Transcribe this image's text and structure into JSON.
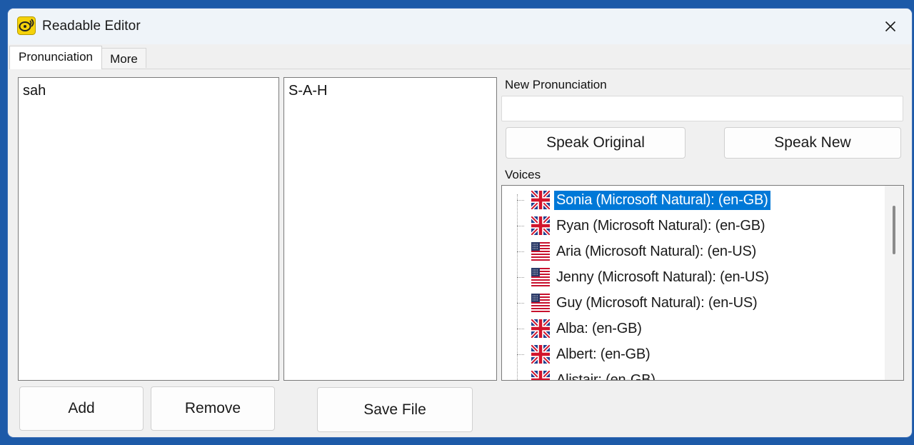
{
  "window": {
    "title": "Readable Editor"
  },
  "tabs": [
    {
      "label": "Pronunciation",
      "active": true
    },
    {
      "label": "More",
      "active": false
    }
  ],
  "words_list": {
    "items": [
      "sah"
    ]
  },
  "pronunciations_list": {
    "items": [
      "S-A-H"
    ]
  },
  "new_pronunciation": {
    "label": "New Pronunciation",
    "value": ""
  },
  "buttons": {
    "speak_original": "Speak Original",
    "speak_new": "Speak New",
    "add": "Add",
    "remove": "Remove",
    "save_file": "Save File"
  },
  "voices": {
    "label": "Voices",
    "items": [
      {
        "text": "Sonia (Microsoft Natural): (en-GB)",
        "flag": "uk-flag-icon",
        "selected": true
      },
      {
        "text": "Ryan (Microsoft Natural): (en-GB)",
        "flag": "uk-flag-icon",
        "selected": false
      },
      {
        "text": "Aria (Microsoft Natural): (en-US)",
        "flag": "us-flag-icon",
        "selected": false
      },
      {
        "text": "Jenny (Microsoft Natural): (en-US)",
        "flag": "us-flag-icon",
        "selected": false
      },
      {
        "text": "Guy (Microsoft Natural): (en-US)",
        "flag": "us-flag-icon",
        "selected": false
      },
      {
        "text": "Alba: (en-GB)",
        "flag": "uk-flag-icon",
        "selected": false
      },
      {
        "text": "Albert: (en-GB)",
        "flag": "uk-flag-icon",
        "selected": false
      },
      {
        "text": "Alistair: (en-GB)",
        "flag": "uk-flag-icon",
        "selected": false
      }
    ]
  },
  "colors": {
    "selection": "#0078d7",
    "desktop": "#1d5aa8",
    "window_bg": "#f0f0f0"
  }
}
